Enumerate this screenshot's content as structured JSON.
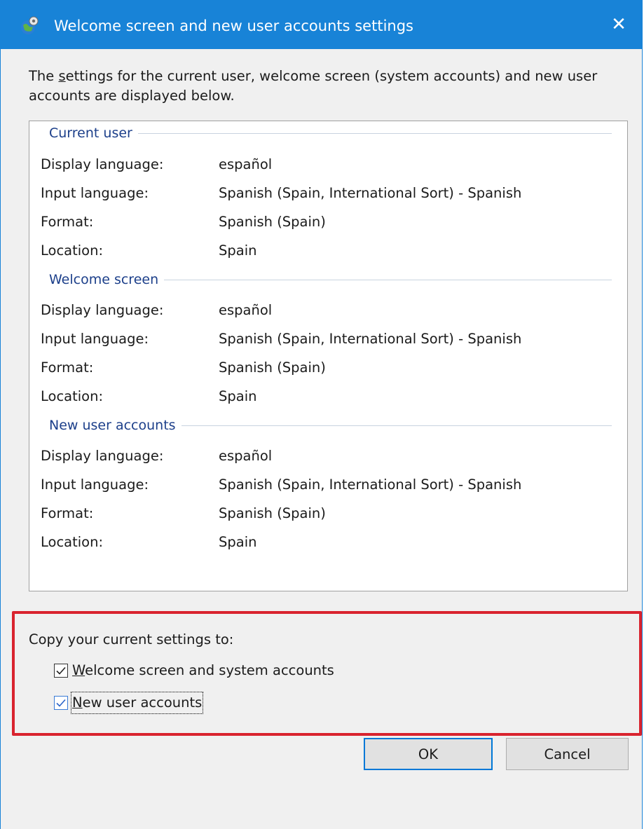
{
  "window": {
    "title": "Welcome screen and new user accounts settings",
    "close_glyph": "✕",
    "accent_color": "#1883d7"
  },
  "intro": {
    "prefix": "The ",
    "accesskey": "s",
    "rest": "ettings for the current user, welcome screen (system accounts) and new user accounts are displayed below."
  },
  "sections": [
    {
      "title": "Current user",
      "rows": [
        {
          "label": "Display language:",
          "value": "español"
        },
        {
          "label": "Input language:",
          "value": "Spanish (Spain, International Sort) - Spanish"
        },
        {
          "label": "Format:",
          "value": "Spanish (Spain)"
        },
        {
          "label": "Location:",
          "value": "Spain"
        }
      ]
    },
    {
      "title": "Welcome screen",
      "rows": [
        {
          "label": "Display language:",
          "value": "español"
        },
        {
          "label": "Input language:",
          "value": "Spanish (Spain, International Sort) - Spanish"
        },
        {
          "label": "Format:",
          "value": "Spanish (Spain)"
        },
        {
          "label": "Location:",
          "value": "Spain"
        }
      ]
    },
    {
      "title": "New user accounts",
      "rows": [
        {
          "label": "Display language:",
          "value": "español"
        },
        {
          "label": "Input language:",
          "value": "Spanish (Spain, International Sort) - Spanish"
        },
        {
          "label": "Format:",
          "value": "Spanish (Spain)"
        },
        {
          "label": "Location:",
          "value": "Spain"
        }
      ]
    }
  ],
  "copy": {
    "label": "Copy your current settings to:",
    "welcome": {
      "accesskey": "W",
      "rest": "elcome screen and system accounts",
      "checked": true
    },
    "newusers": {
      "accesskey": "N",
      "rest": "ew user accounts",
      "checked": true
    }
  },
  "buttons": {
    "ok": "OK",
    "cancel": "Cancel"
  },
  "highlight_color": "#d9232e"
}
